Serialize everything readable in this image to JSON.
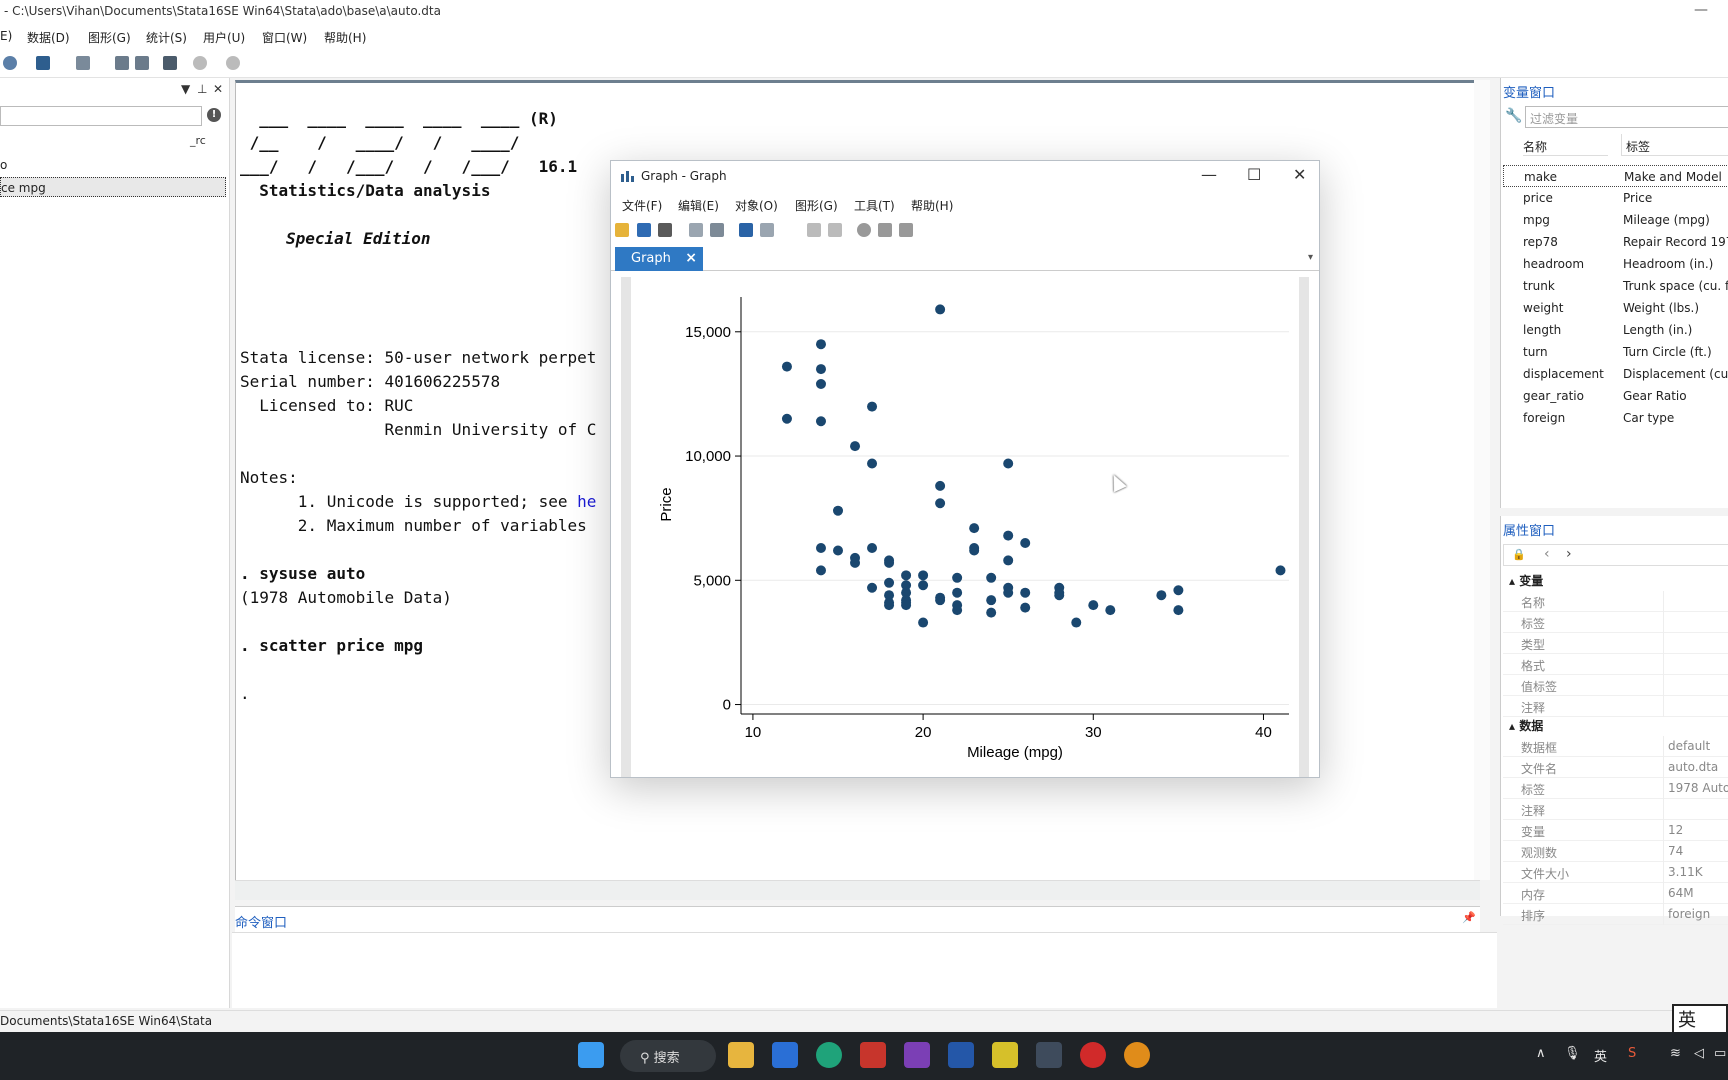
{
  "window": {
    "title": "- C:\\Users\\Vihan\\Documents\\Stata16SE Win64\\Stata\\ado\\base\\a\\auto.dta",
    "minimize": "—"
  },
  "menu": [
    "E)",
    "数据(D)",
    "图形(G)",
    "统计(S)",
    "用户(U)",
    "窗口(W)",
    "帮助(H)"
  ],
  "left_panel": {
    "col_header": "_rc",
    "rows": [
      "o",
      "ce mpg"
    ],
    "alert_glyph": "!"
  },
  "results": {
    "logo": [
      "  ___  ____  ____  ____  ____ (R)",
      " /__    /   ____/   /   ____/",
      "___/   /   /___/   /   /___/   16.1"
    ],
    "lines": [
      "  Statistics/Data analysis",
      "Special Edition",
      "Stata license: 50-user network perpet",
      "Serial number: 401606225578",
      "  Licensed to: RUC",
      "               Renmin University of C",
      "Notes:",
      "      1. Unicode is supported; see ",
      "he",
      "      2. Maximum number of variables",
      ". sysuse auto",
      "(1978 Automobile Data)",
      ". scatter price mpg",
      "."
    ]
  },
  "command_window": {
    "title": "命令窗口",
    "pin": "📌"
  },
  "variables_panel": {
    "title": "变量窗口",
    "filter_placeholder": "过滤变量",
    "col_name": "名称",
    "col_label": "标签",
    "rows": [
      {
        "name": "make",
        "label": "Make and Model"
      },
      {
        "name": "price",
        "label": "Price"
      },
      {
        "name": "mpg",
        "label": "Mileage (mpg)"
      },
      {
        "name": "rep78",
        "label": "Repair Record 197"
      },
      {
        "name": "headroom",
        "label": "Headroom (in.)"
      },
      {
        "name": "trunk",
        "label": "Trunk space (cu. ft"
      },
      {
        "name": "weight",
        "label": "Weight (lbs.)"
      },
      {
        "name": "length",
        "label": "Length (in.)"
      },
      {
        "name": "turn",
        "label": "Turn Circle (ft.)"
      },
      {
        "name": "displacement",
        "label": "Displacement (cu."
      },
      {
        "name": "gear_ratio",
        "label": "Gear Ratio"
      },
      {
        "name": "foreign",
        "label": "Car type"
      }
    ]
  },
  "properties_panel": {
    "title": "属性窗口",
    "section_var": "变量",
    "var_rows": [
      "名称",
      "标签",
      "类型",
      "格式",
      "值标签",
      "注释"
    ],
    "section_data": "数据",
    "data_rows": [
      {
        "k": "数据框",
        "v": "default"
      },
      {
        "k": "文件名",
        "v": "auto.dta"
      },
      {
        "k": "标签",
        "v": "1978 Autom"
      },
      {
        "k": "注释",
        "v": ""
      },
      {
        "k": "变量",
        "v": "12"
      },
      {
        "k": "观测数",
        "v": "74"
      },
      {
        "k": "文件大小",
        "v": "3.11K"
      },
      {
        "k": "内存",
        "v": "64M"
      },
      {
        "k": "排序",
        "v": "foreign"
      }
    ]
  },
  "statusbar": {
    "path": "Documents\\Stata16SE Win64\\Stata"
  },
  "ime_indicator": "英",
  "taskbar": {
    "search_label": "搜索",
    "tray_lang": "英"
  },
  "graph_window": {
    "title": "Graph - Graph",
    "menu": [
      "文件(F)",
      "编辑(E)",
      "对象(O)",
      "图形(G)",
      "工具(T)",
      "帮助(H)"
    ],
    "tab_label": "Graph",
    "tab_close": "×"
  },
  "chart_data": {
    "type": "scatter",
    "title": "",
    "xlabel": "Mileage (mpg)",
    "ylabel": "Price",
    "xlim": [
      9.3,
      41.5
    ],
    "ylim": [
      -300,
      16400
    ],
    "xticks": [
      10,
      20,
      30,
      40
    ],
    "xtick_labels": [
      "10",
      "20",
      "30",
      "40"
    ],
    "yticks": [
      0,
      5000,
      10000,
      15000
    ],
    "ytick_labels": [
      "0",
      "5,000",
      "10,000",
      "15,000"
    ],
    "grid": "horizontal",
    "marker_color": "#1a476f",
    "points": [
      [
        12,
        13600
      ],
      [
        12,
        11500
      ],
      [
        14,
        14500
      ],
      [
        14,
        13500
      ],
      [
        14,
        12900
      ],
      [
        14,
        11400
      ],
      [
        14,
        6300
      ],
      [
        14,
        5400
      ],
      [
        15,
        7800
      ],
      [
        15,
        6200
      ],
      [
        16,
        10400
      ],
      [
        16,
        5900
      ],
      [
        16,
        5700
      ],
      [
        17,
        11990
      ],
      [
        17,
        9700
      ],
      [
        17,
        6300
      ],
      [
        17,
        4700
      ],
      [
        18,
        5800
      ],
      [
        18,
        5700
      ],
      [
        18,
        4900
      ],
      [
        18,
        4400
      ],
      [
        18,
        4100
      ],
      [
        18,
        4000
      ],
      [
        19,
        5200
      ],
      [
        19,
        4800
      ],
      [
        19,
        4500
      ],
      [
        19,
        4200
      ],
      [
        19,
        4000
      ],
      [
        19,
        4100
      ],
      [
        20,
        5200
      ],
      [
        20,
        4800
      ],
      [
        20,
        3300
      ],
      [
        21,
        15900
      ],
      [
        21,
        8800
      ],
      [
        21,
        8100
      ],
      [
        21,
        4300
      ],
      [
        21,
        4200
      ],
      [
        22,
        5100
      ],
      [
        22,
        4500
      ],
      [
        22,
        4000
      ],
      [
        22,
        3800
      ],
      [
        23,
        7100
      ],
      [
        23,
        6300
      ],
      [
        23,
        6200
      ],
      [
        24,
        5100
      ],
      [
        24,
        4200
      ],
      [
        24,
        3700
      ],
      [
        25,
        9700
      ],
      [
        25,
        6800
      ],
      [
        25,
        5800
      ],
      [
        25,
        4700
      ],
      [
        25,
        4500
      ],
      [
        26,
        6500
      ],
      [
        26,
        4500
      ],
      [
        26,
        3900
      ],
      [
        28,
        4700
      ],
      [
        28,
        4500
      ],
      [
        28,
        4400
      ],
      [
        29,
        3300
      ],
      [
        30,
        4000
      ],
      [
        31,
        3800
      ],
      [
        34,
        4400
      ],
      [
        35,
        4600
      ],
      [
        35,
        3800
      ],
      [
        41,
        5400
      ]
    ]
  }
}
